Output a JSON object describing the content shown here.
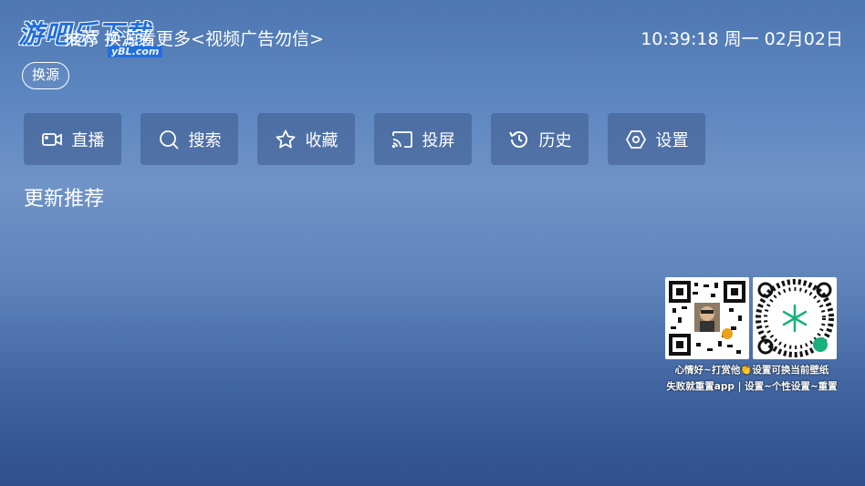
{
  "watermark": {
    "title": "游吧乐下载",
    "sub": "yBL.com"
  },
  "header": {
    "notice": "推荐 换源看更多<视频广告勿信>",
    "clock": "10:39:18 周一 02月02日"
  },
  "source_button": {
    "label": "换源"
  },
  "nav": {
    "items": [
      {
        "label": "直播",
        "icon": "video-camera-icon"
      },
      {
        "label": "搜索",
        "icon": "search-icon"
      },
      {
        "label": "收藏",
        "icon": "star-icon"
      },
      {
        "label": "投屏",
        "icon": "cast-icon"
      },
      {
        "label": "历史",
        "icon": "history-icon"
      },
      {
        "label": "设置",
        "icon": "settings-hexagon-icon"
      }
    ]
  },
  "section": {
    "title": "更新推荐"
  },
  "qr": {
    "caption1": "心情好~打赏他👏设置可换当前壁纸",
    "caption2": "失败就重置app | 设置~个性设置~重置"
  }
}
